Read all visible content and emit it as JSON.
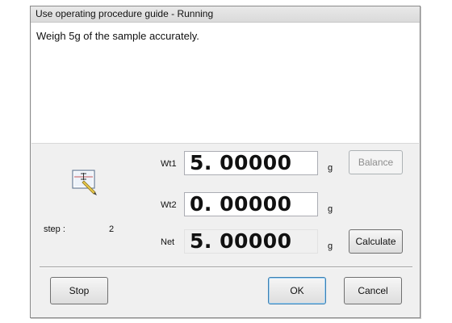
{
  "window": {
    "title": "Use operating procedure guide - Running"
  },
  "message": {
    "text": "Weigh 5g of the sample accurately."
  },
  "step": {
    "label": "step :",
    "value": "2"
  },
  "fields": {
    "wt1": {
      "label": "Wt1",
      "value": "5. 00000",
      "unit": "g"
    },
    "wt2": {
      "label": "Wt2",
      "value": "0. 00000",
      "unit": "g"
    },
    "net": {
      "label": "Net",
      "value": "5. 00000",
      "unit": "g"
    }
  },
  "buttons": {
    "balance": "Balance",
    "calculate": "Calculate",
    "stop": "Stop",
    "ok": "OK",
    "cancel": "Cancel"
  },
  "icons": {
    "status": "balance-pen-icon"
  }
}
